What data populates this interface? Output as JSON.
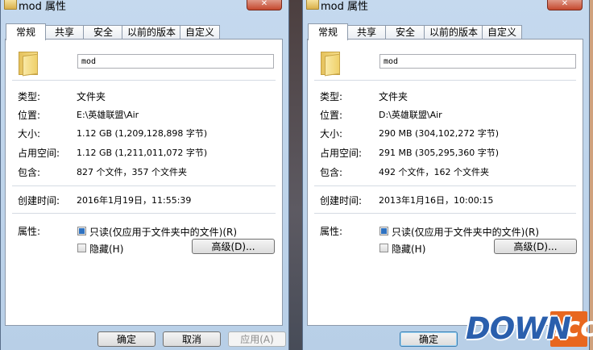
{
  "left": {
    "title": "mod 属性",
    "tabs": [
      "常规",
      "共享",
      "安全",
      "以前的版本",
      "自定义"
    ],
    "name": "mod",
    "rows": {
      "type": {
        "label": "类型:",
        "value": "文件夹"
      },
      "location": {
        "label": "位置:",
        "value": "E:\\英雄联盟\\Air"
      },
      "size": {
        "label": "大小:",
        "value": "1.12 GB (1,209,128,898 字节)"
      },
      "disk": {
        "label": "占用空间:",
        "value": "1.12 GB (1,211,011,072 字节)"
      },
      "contains": {
        "label": "包含:",
        "value": "827 个文件，357 个文件夹"
      },
      "created": {
        "label": "创建时间:",
        "value": "2016年1月19日，11:55:39"
      }
    },
    "attributes_label": "属性:",
    "readonly_label": "只读(仅应用于文件夹中的文件)(R)",
    "hidden_label": "隐藏(H)",
    "advanced_button": "高级(D)...",
    "ok_button": "确定",
    "cancel_button": "取消",
    "apply_button": "应用(A)"
  },
  "right": {
    "title": "mod 属性",
    "tabs": [
      "常规",
      "共享",
      "安全",
      "以前的版本",
      "自定义"
    ],
    "name": "mod",
    "rows": {
      "type": {
        "label": "类型:",
        "value": "文件夹"
      },
      "location": {
        "label": "位置:",
        "value": "D:\\英雄联盟\\Air"
      },
      "size": {
        "label": "大小:",
        "value": "290 MB (304,102,272 字节)"
      },
      "disk": {
        "label": "占用空间:",
        "value": "291 MB (305,295,360 字节)"
      },
      "contains": {
        "label": "包含:",
        "value": "492 个文件，162 个文件夹"
      },
      "created": {
        "label": "创建时间:",
        "value": "2013年1月16日，10:00:15"
      }
    },
    "attributes_label": "属性:",
    "readonly_label": "只读(仅应用于文件夹中的文件)(R)",
    "hidden_label": "隐藏(H)",
    "advanced_button": "高级(D)...",
    "ok_button": "确定"
  },
  "watermark": {
    "brand": "DOWN",
    "suffix": ".cc"
  },
  "colors": {
    "dialog_frame": "#c5d9ee",
    "checkbox_fill": "#2f73c2",
    "watermark_blue": "#2a5fad",
    "watermark_orange": "#e8671f"
  }
}
